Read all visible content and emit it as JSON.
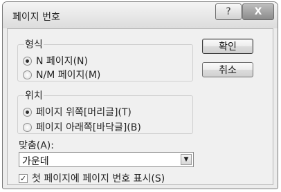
{
  "dialog": {
    "title": "페이지 번호",
    "help_symbol": "?",
    "close_symbol": "X"
  },
  "format": {
    "label": "형식",
    "options": [
      {
        "label": "N 페이지(N)",
        "selected": true
      },
      {
        "label": "N/M 페이지(M)",
        "selected": false
      }
    ]
  },
  "position": {
    "label": "위치",
    "options": [
      {
        "label": "페이지 위쪽[머리글](T)",
        "selected": true
      },
      {
        "label": "페이지 아래쪽[바닥글](B)",
        "selected": false
      }
    ]
  },
  "alignment": {
    "label": "맞춤(A):",
    "value": "가운데"
  },
  "show_on_first_page": {
    "label": "첫 페이지에 페이지 번호 표시(S)",
    "checked": true
  },
  "buttons": {
    "ok": "확인",
    "cancel": "취소"
  }
}
